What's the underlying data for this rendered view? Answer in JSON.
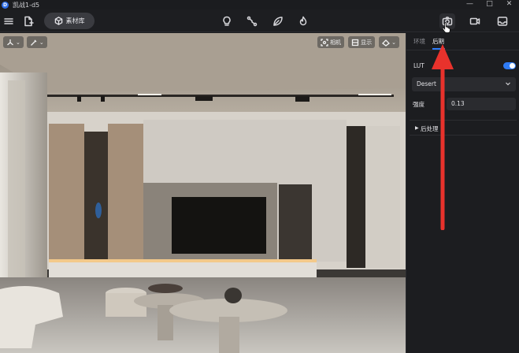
{
  "window": {
    "title": "凯战1-d5",
    "logo_letter": "D",
    "controls": [
      "—",
      "□",
      "✕"
    ]
  },
  "toolbar": {
    "asset_library_label": "素材库",
    "icons": [
      "menu-icon",
      "new-file-icon",
      "bulb-icon",
      "path-icon",
      "leaf-icon",
      "fire-icon",
      "camera-icon",
      "video-icon",
      "inbox-icon"
    ]
  },
  "viewport": {
    "left_tools": [
      "axis-gizmo-icon",
      "brush-icon"
    ],
    "camera_label": "相机",
    "display_label": "显示",
    "extra_tool": "view-mode-icon"
  },
  "panel": {
    "tabs": [
      {
        "label": "环境",
        "active": false
      },
      {
        "label": "后期",
        "active": true
      }
    ],
    "lut_label": "LUT",
    "lut_enabled": true,
    "lut_value": "Desert",
    "strength_label": "强度",
    "strength_value": "0.13",
    "post_section_label": "后处理"
  },
  "colors": {
    "accent": "#2f7cf6",
    "annotation_arrow": "#e8322c",
    "background": "#1c1d20"
  }
}
